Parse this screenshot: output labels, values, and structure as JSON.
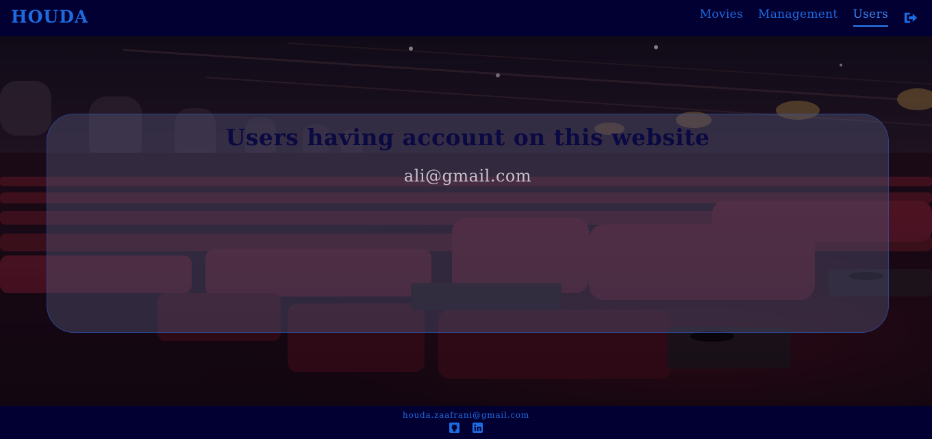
{
  "navbar": {
    "brand": "HOUDA",
    "links": [
      {
        "label": "Movies",
        "active": false
      },
      {
        "label": "Management",
        "active": false
      },
      {
        "label": "Users",
        "active": true
      }
    ],
    "logout_icon": "sign-out-icon"
  },
  "main": {
    "title": "Users having account on this website",
    "users": [
      "ali@gmail.com"
    ]
  },
  "footer": {
    "email": "houda.zaafrani@gmail.com",
    "icons": [
      "github-icon",
      "linkedin-icon"
    ]
  },
  "colors": {
    "navbar_bg": "#020033",
    "accent": "#1d6be0",
    "title": "#0a0942"
  }
}
